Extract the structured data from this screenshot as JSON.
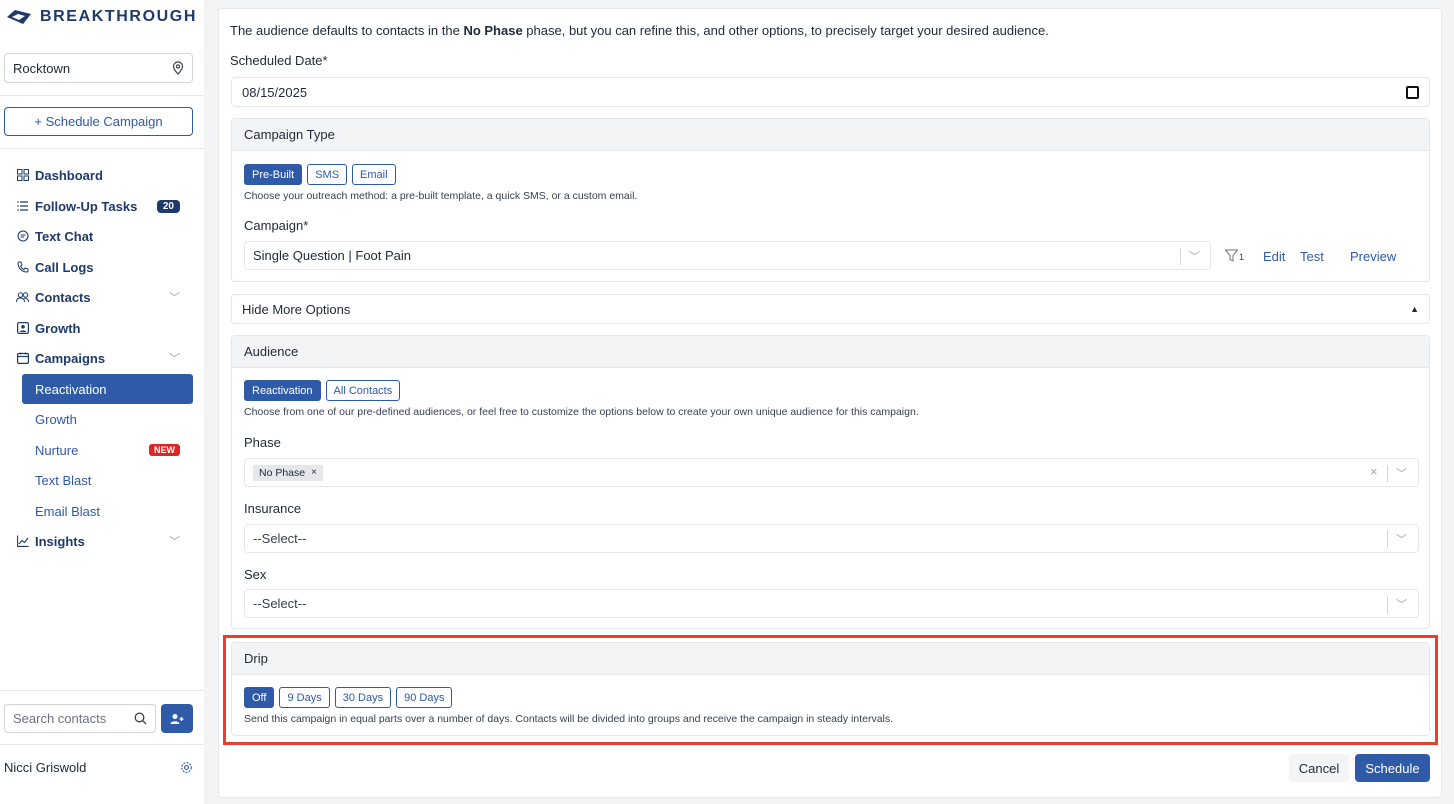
{
  "brand": {
    "name": "BREAKTHROUGH"
  },
  "sidebar": {
    "location": "Rocktown",
    "schedule_button": "+ Schedule Campaign",
    "nav": {
      "dashboard": "Dashboard",
      "followup": "Follow-Up Tasks",
      "followup_count": "20",
      "text_chat": "Text Chat",
      "call_logs": "Call Logs",
      "contacts": "Contacts",
      "growth": "Growth",
      "campaigns": "Campaigns",
      "insights": "Insights"
    },
    "campaign_items": {
      "reactivation": "Reactivation",
      "growth": "Growth",
      "nurture": "Nurture",
      "nurture_badge": "NEW",
      "text_blast": "Text Blast",
      "email_blast": "Email Blast"
    },
    "search_placeholder": "Search contacts",
    "user_name": "Nicci Griswold"
  },
  "form": {
    "intro_prefix": "The audience defaults to contacts in the ",
    "intro_bold": "No Phase",
    "intro_suffix": " phase, but you can refine this, and other options, to precisely target your desired audience.",
    "scheduled_date_label": "Scheduled Date*",
    "scheduled_date_value": "08/15/2025",
    "campaign_type": {
      "title": "Campaign Type",
      "options": [
        "Pre-Built",
        "SMS",
        "Email"
      ],
      "selected": "Pre-Built",
      "help": "Choose your outreach method: a pre-built template, a quick SMS, or a custom email.",
      "campaign_label": "Campaign*",
      "campaign_value": "Single Question | Foot Pain",
      "filter_count": "1",
      "edit": "Edit",
      "test": "Test",
      "preview": "Preview"
    },
    "more_options_label": "Hide More Options",
    "audience": {
      "title": "Audience",
      "options": [
        "Reactivation",
        "All Contacts"
      ],
      "selected": "Reactivation",
      "help": "Choose from one of our pre-defined audiences, or feel free to customize the options below to create your own unique audience for this campaign.",
      "phase_label": "Phase",
      "phase_tag": "No Phase",
      "insurance_label": "Insurance",
      "insurance_value": "--Select--",
      "sex_label": "Sex",
      "sex_value": "--Select--"
    },
    "drip": {
      "title": "Drip",
      "options": [
        "Off",
        "9 Days",
        "30 Days",
        "90 Days"
      ],
      "selected": "Off",
      "help": "Send this campaign in equal parts over a number of days. Contacts will be divided into groups and receive the campaign in steady intervals."
    },
    "cancel": "Cancel",
    "schedule": "Schedule"
  },
  "colors": {
    "primary": "#2f5aa8",
    "navy": "#1e3a6b",
    "highlight": "#e5412d",
    "new_badge": "#dc2626"
  }
}
